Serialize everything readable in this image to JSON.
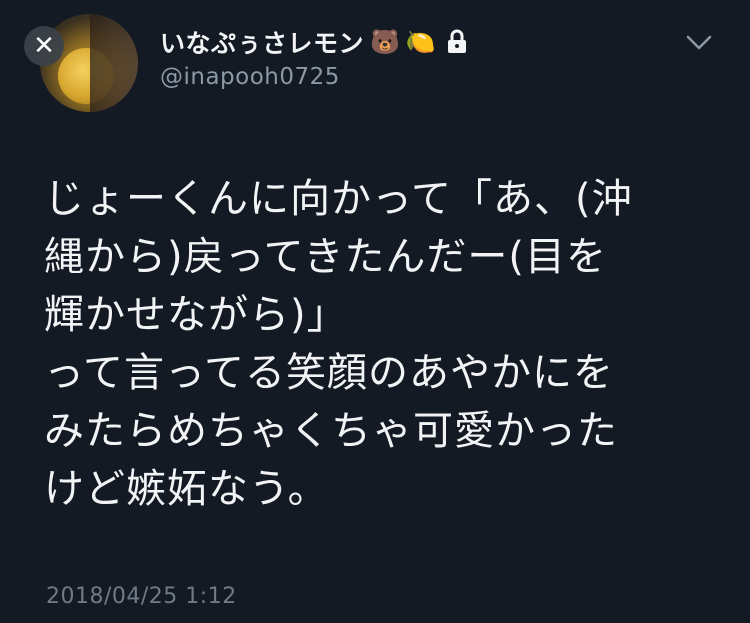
{
  "header": {
    "close_icon": "close-icon",
    "display_name": "いなぷぅさレモン",
    "emoji_1": "🐻",
    "emoji_2": "🍋",
    "lock_icon": "lock-icon",
    "handle": "@inapooh0725",
    "menu_icon": "chevron-down-icon"
  },
  "tweet": {
    "lines": [
      "じょーくんに向かって「あ、(沖",
      "縄から)戻ってきたんだー(目を",
      "輝かせながら)」",
      "って言ってる笑顔のあやかにを",
      "みたらめちゃくちゃ可愛かった",
      "けど嫉妬なう。"
    ],
    "timestamp": "2018/04/25 1:12"
  },
  "colors": {
    "background": "#141a24",
    "text": "#f1f3f5",
    "muted": "#8b98a5"
  }
}
